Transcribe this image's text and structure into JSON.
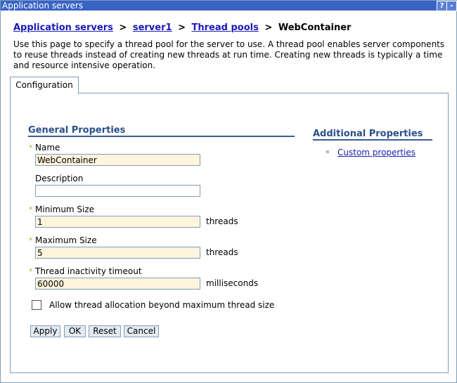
{
  "window": {
    "title": "Application servers",
    "help_button": "?",
    "minimize_button": "-"
  },
  "breadcrumb": {
    "links": [
      "Application servers",
      "server1",
      "Thread pools"
    ],
    "separator": ">",
    "current": "WebContainer"
  },
  "description": "Use this page to specify a thread pool for the server to use. A thread pool enables server components to reuse threads instead of creating new threads at run time. Creating new threads is typically a time and resource intensive operation.",
  "tabs": {
    "configuration": "Configuration"
  },
  "general_properties": {
    "heading": "General Properties",
    "required_marker": "*",
    "name": {
      "label": "Name",
      "value": "WebContainer"
    },
    "description": {
      "label": "Description",
      "value": ""
    },
    "minimum_size": {
      "label": "Minimum Size",
      "value": "1",
      "unit": "threads"
    },
    "maximum_size": {
      "label": "Maximum Size",
      "value": "5",
      "unit": "threads"
    },
    "inactivity_timeout": {
      "label": "Thread inactivity timeout",
      "value": "60000",
      "unit": "milliseconds"
    },
    "allow_beyond_max": {
      "label": "Allow thread allocation beyond maximum thread size",
      "checked": false
    }
  },
  "buttons": {
    "apply": "Apply",
    "ok": "OK",
    "reset": "Reset",
    "cancel": "Cancel"
  },
  "additional_properties": {
    "heading": "Additional Properties",
    "links": [
      "Custom properties"
    ]
  },
  "colors": {
    "title_bar": "#3a63c6",
    "link": "#1a1ab8",
    "section_heading": "#2a4f8a",
    "required_field_bg": "#fff4dc",
    "required_marker": "#c79a1c",
    "button_bg": "#e4eaf2",
    "border": "#7f9db9"
  }
}
